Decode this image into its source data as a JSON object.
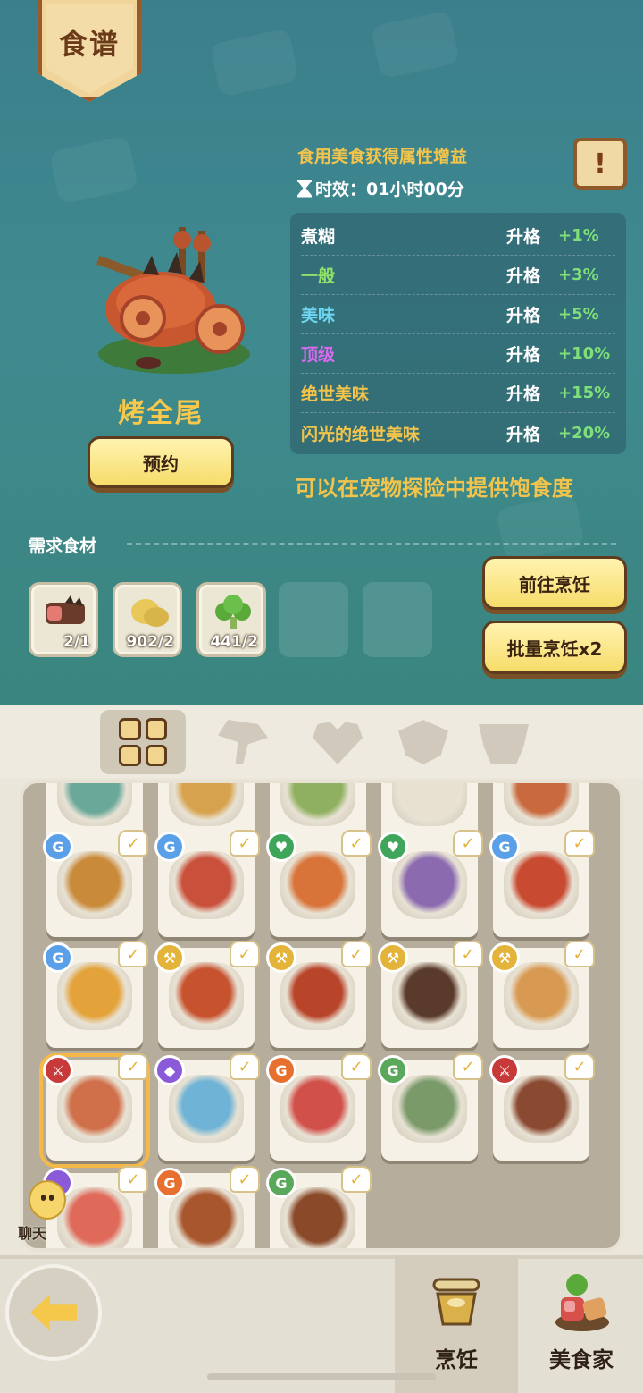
{
  "header": {
    "title": "食谱"
  },
  "dish": {
    "name": "烤全尾",
    "reserve_label": "预约",
    "bonus_title": "食用美食获得属性增益",
    "duration": "时效：01小时00分",
    "pet_note": "可以在宠物探险中提供饱食度"
  },
  "quality_rows": [
    {
      "name": "煮糊",
      "upgrade": "升格",
      "bonus": "+1%",
      "color": "#ffffff"
    },
    {
      "name": "一般",
      "upgrade": "升格",
      "bonus": "+3%",
      "color": "#8fe36a"
    },
    {
      "name": "美味",
      "upgrade": "升格",
      "bonus": "+5%",
      "color": "#6fd6f2"
    },
    {
      "name": "顶级",
      "upgrade": "升格",
      "bonus": "+10%",
      "color": "#d66bf0"
    },
    {
      "name": "绝世美味",
      "upgrade": "升格",
      "bonus": "+15%",
      "color": "#f2c44c"
    },
    {
      "name": "闪光的绝世美味",
      "upgrade": "升格",
      "bonus": "+20%",
      "color": "#f2c44c"
    }
  ],
  "ingredients": {
    "label": "需求食材",
    "items": [
      {
        "icon": "meat-icon",
        "count": "2/1"
      },
      {
        "icon": "potato-icon",
        "count": "902/2"
      },
      {
        "icon": "broccoli-icon",
        "count": "441/2"
      }
    ]
  },
  "actions": {
    "goto_cook": "前往烹饪",
    "batch_cook": "批量烹饪x2"
  },
  "category_tabs": [
    "all-grid-icon",
    "axe-icon",
    "heart-icon",
    "shield-icon",
    "helmet-icon"
  ],
  "recipes": [
    [
      {
        "badge": "",
        "badge_color": "",
        "plate": "#6aa89a"
      },
      {
        "badge": "",
        "badge_color": "",
        "plate": "#d7a24e"
      },
      {
        "badge": "",
        "badge_color": "",
        "plate": "#8fb060"
      },
      {
        "badge": "",
        "badge_color": "",
        "plate": "#e8e0d0"
      },
      {
        "badge": "",
        "badge_color": "",
        "plate": "#c86a3e"
      }
    ],
    [
      {
        "badge": "G",
        "badge_color": "#5aa0e8",
        "plate": "#c98a3a"
      },
      {
        "badge": "G",
        "badge_color": "#5aa0e8",
        "plate": "#c9503a"
      },
      {
        "badge": "♥",
        "badge_color": "#3fa55a",
        "plate": "#d8743a"
      },
      {
        "badge": "♥",
        "badge_color": "#3fa55a",
        "plate": "#8b6ab0"
      },
      {
        "badge": "G",
        "badge_color": "#5aa0e8",
        "plate": "#c84a30"
      }
    ],
    [
      {
        "badge": "G",
        "badge_color": "#5aa0e8",
        "plate": "#e3a23a"
      },
      {
        "badge": "⚒",
        "badge_color": "#e4b33a",
        "plate": "#c6522e"
      },
      {
        "badge": "⚒",
        "badge_color": "#e4b33a",
        "plate": "#b8452a"
      },
      {
        "badge": "⚒",
        "badge_color": "#e4b33a",
        "plate": "#5a3a2a"
      },
      {
        "badge": "⚒",
        "badge_color": "#e4b33a",
        "plate": "#d89a52"
      }
    ],
    [
      {
        "badge": "⚔",
        "badge_color": "#c83a3a",
        "plate": "#d0704a",
        "selected": true
      },
      {
        "badge": "◆",
        "badge_color": "#8a5ad8",
        "plate": "#6fb3d6"
      },
      {
        "badge": "G",
        "badge_color": "#e8702e",
        "plate": "#d2504a"
      },
      {
        "badge": "G",
        "badge_color": "#5aa85a",
        "plate": "#7a9a6a"
      },
      {
        "badge": "⚔",
        "badge_color": "#c83a3a",
        "plate": "#8a4a32"
      }
    ],
    [
      {
        "badge": "",
        "badge_color": "#8a5ad8",
        "plate": "#e06a5a"
      },
      {
        "badge": "G",
        "badge_color": "#e8702e",
        "plate": "#a8562e"
      },
      {
        "badge": "G",
        "badge_color": "#5aa85a",
        "plate": "#8a4a2a"
      }
    ]
  ],
  "check_mark": "✓",
  "chat": {
    "label": "聊天"
  },
  "footer": {
    "cook_label": "烹饪",
    "gourmet_label": "美食家"
  }
}
